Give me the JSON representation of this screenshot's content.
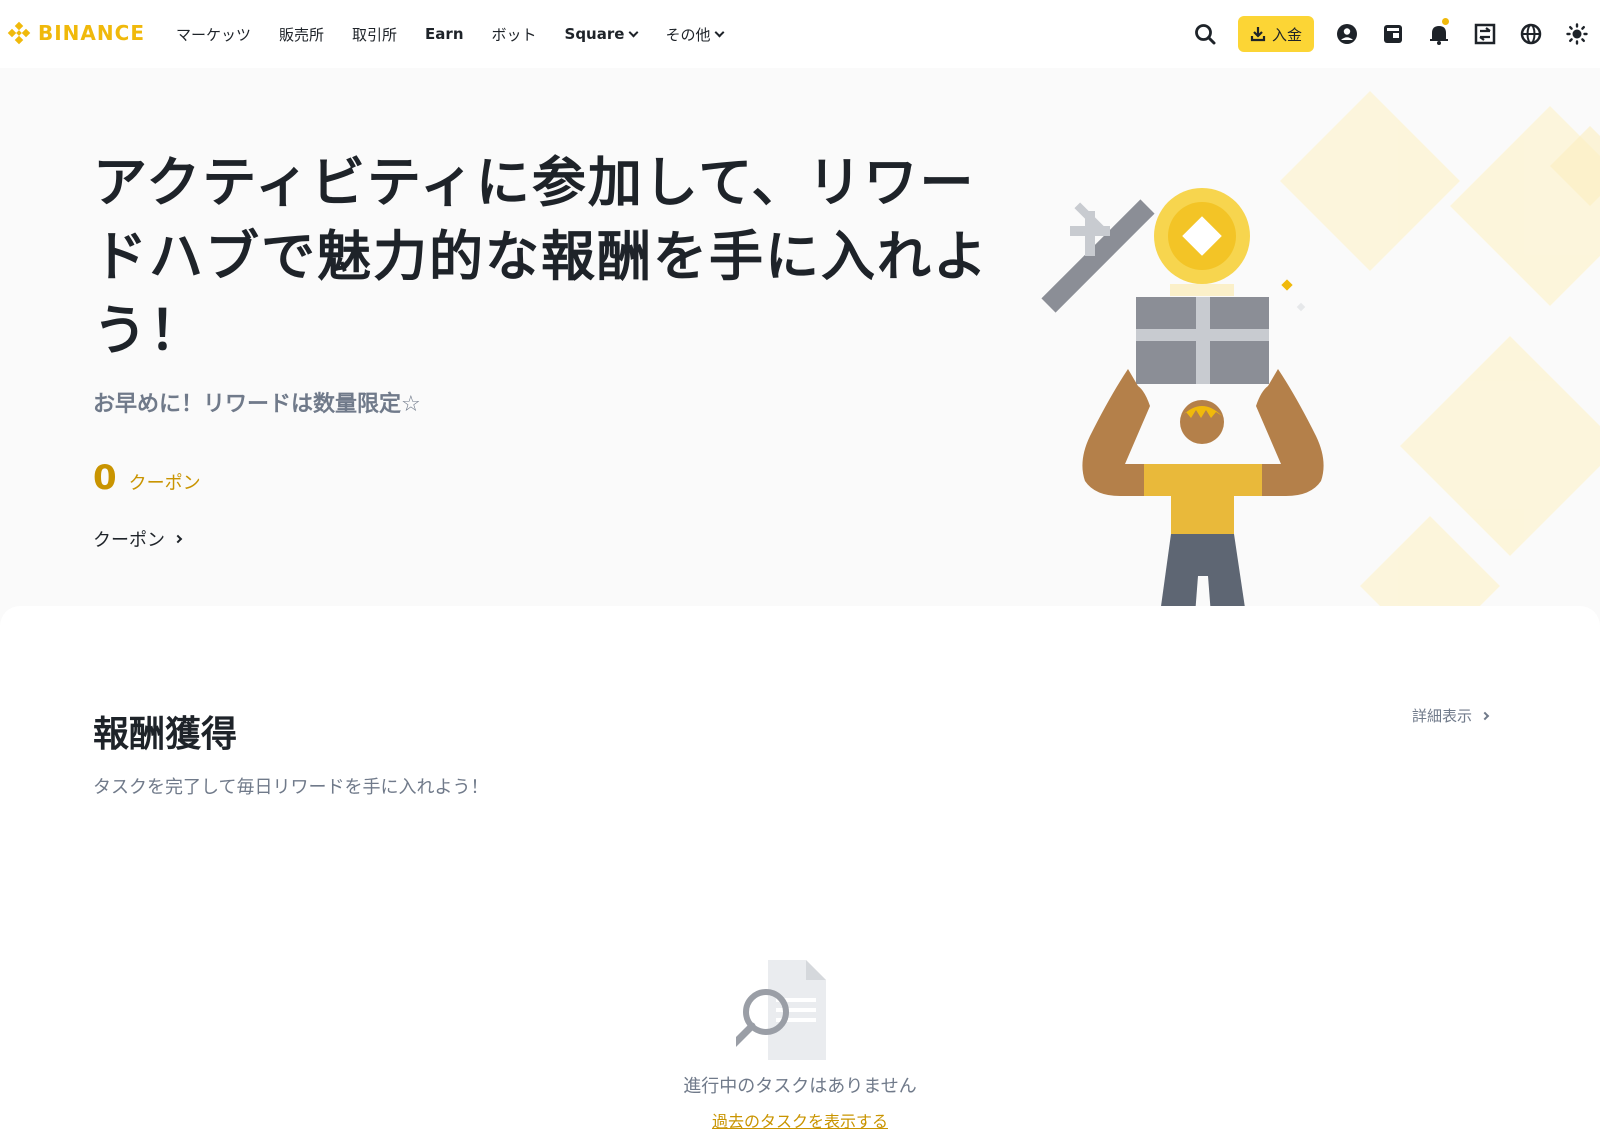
{
  "brand": {
    "name": "BINANCE",
    "accent": "#f0b90b",
    "button_color": "#fcd535"
  },
  "nav": {
    "items": [
      {
        "label": "マーケッツ",
        "dropdown": false
      },
      {
        "label": "販売所",
        "dropdown": false
      },
      {
        "label": "取引所",
        "dropdown": false
      },
      {
        "label": "Earn",
        "dropdown": false
      },
      {
        "label": "ボット",
        "dropdown": false
      },
      {
        "label": "Square",
        "dropdown": true
      },
      {
        "label": "その他",
        "dropdown": true
      }
    ]
  },
  "header": {
    "deposit_label": "入金",
    "icons": [
      "search-icon",
      "download-icon",
      "user-icon",
      "wallet-icon",
      "bell-icon",
      "transfer-icon",
      "globe-icon",
      "theme-icon"
    ]
  },
  "hero": {
    "title": "アクティビティに参加して、リワードハブで魅力的な報酬を手に入れよう！",
    "subtitle": "お早めに！リワードは数量限定☆",
    "coupon_count": "0",
    "coupon_unit": "クーポン",
    "coupon_link": "クーポン"
  },
  "rewards": {
    "title": "報酬獲得",
    "description": "タスクを完了して毎日リワードを手に入れよう！",
    "details_link": "詳細表示",
    "empty_text": "進行中のタスクはありません",
    "past_link": "過去のタスクを表示する"
  }
}
